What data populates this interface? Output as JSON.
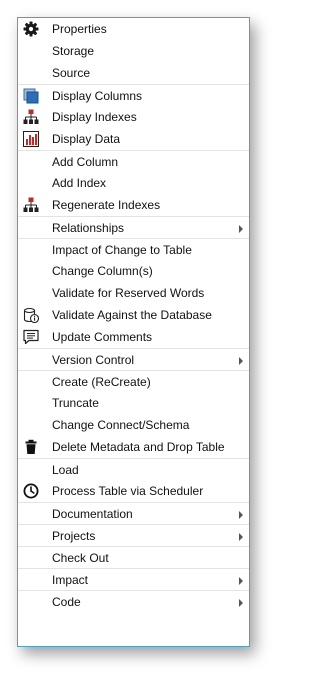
{
  "menu": {
    "items": [
      {
        "label": "Properties",
        "icon": "gear-icon"
      },
      {
        "label": "Storage"
      },
      {
        "label": "Source"
      },
      {
        "label": "Display Columns",
        "icon": "columns-icon"
      },
      {
        "label": "Display Indexes",
        "icon": "hierarchy-icon"
      },
      {
        "label": "Display Data",
        "icon": "bar-chart-icon"
      },
      {
        "label": "Add Column"
      },
      {
        "label": "Add Index"
      },
      {
        "label": "Regenerate Indexes",
        "icon": "hierarchy-icon"
      },
      {
        "label": "Relationships",
        "submenu": true
      },
      {
        "label": "Impact of Change to Table"
      },
      {
        "label": "Change Column(s)"
      },
      {
        "label": "Validate for Reserved Words"
      },
      {
        "label": "Validate Against the Database",
        "icon": "database-info-icon"
      },
      {
        "label": "Update Comments",
        "icon": "comment-icon"
      },
      {
        "label": "Version Control",
        "submenu": true
      },
      {
        "label": "Create (ReCreate)"
      },
      {
        "label": "Truncate"
      },
      {
        "label": "Change Connect/Schema"
      },
      {
        "label": "Delete Metadata and Drop Table",
        "icon": "trash-icon"
      },
      {
        "label": "Load"
      },
      {
        "label": "Process Table via Scheduler",
        "icon": "clock-icon"
      },
      {
        "label": "Documentation",
        "submenu": true
      },
      {
        "label": "Projects",
        "submenu": true
      },
      {
        "label": "Check Out"
      },
      {
        "label": "Impact",
        "submenu": true
      },
      {
        "label": "Code",
        "submenu": true
      }
    ]
  },
  "colors": {
    "border": "#4ba3c7",
    "icon_blue": "#2d6db5",
    "icon_red": "#c62828",
    "separator": "#e3e3e3"
  }
}
